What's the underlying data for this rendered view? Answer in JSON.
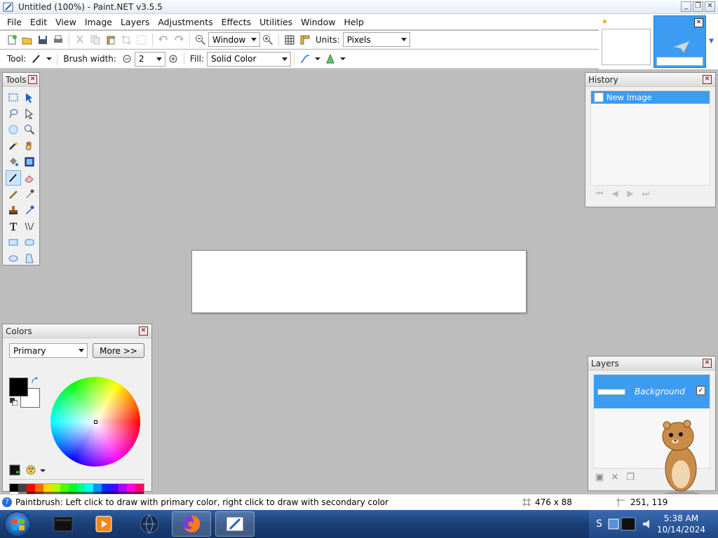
{
  "window": {
    "title": "Untitled (100%) - Paint.NET v3.5.5",
    "minimize": "_",
    "restore": "❐",
    "close": "✕"
  },
  "menu": [
    "File",
    "Edit",
    "View",
    "Image",
    "Layers",
    "Adjustments",
    "Effects",
    "Utilities",
    "Window",
    "Help"
  ],
  "toolbar": {
    "zoom_value": "Window",
    "units_label": "Units:",
    "units_value": "Pixels",
    "tool_label": "Tool:",
    "brush_width_label": "Brush width:",
    "brush_width_value": "2",
    "fill_label": "Fill:",
    "fill_value": "Solid Color"
  },
  "panels": {
    "tools_title": "Tools",
    "history_title": "History",
    "history_items": [
      "New Image"
    ],
    "layers_title": "Layers",
    "layer_name": "Background",
    "colors_title": "Colors",
    "colors_mode": "Primary",
    "more_button": "More >>"
  },
  "status": {
    "hint": "Paintbrush: Left click to draw with primary color, right click to draw with secondary color",
    "size": "476 x 88",
    "cursor": "251, 119"
  },
  "taskbar": {
    "time": "5:38 AM",
    "date": "10/14/2024",
    "tray_text": "S"
  },
  "colors": {
    "accent": "#3b9cf2",
    "primary": "#000000",
    "secondary": "#ffffff"
  }
}
